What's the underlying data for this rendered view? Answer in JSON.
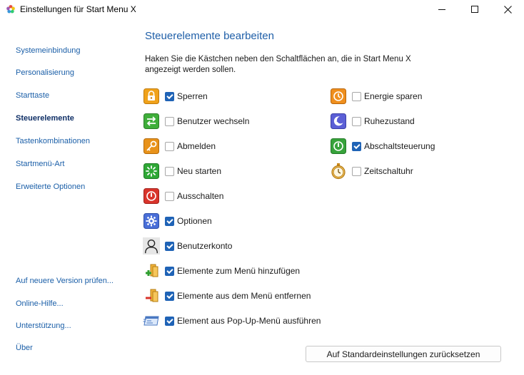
{
  "window": {
    "title": "Einstellungen für Start Menu X",
    "controls": [
      "minimize",
      "maximize",
      "close"
    ]
  },
  "sidebar": {
    "top_items": [
      {
        "label": "Systemeinbindung",
        "active": false
      },
      {
        "label": "Personalisierung",
        "active": false
      },
      {
        "label": "Starttaste",
        "active": false
      },
      {
        "label": "Steuerelemente",
        "active": true
      },
      {
        "label": "Tastenkombinationen",
        "active": false
      },
      {
        "label": "Startmenü-Art",
        "active": false
      },
      {
        "label": "Erweiterte Optionen",
        "active": false
      }
    ],
    "bottom_items": [
      {
        "label": "Auf neuere Version prüfen..."
      },
      {
        "label": "Online-Hilfe..."
      },
      {
        "label": "Unterstützung..."
      },
      {
        "label": "Über"
      }
    ]
  },
  "main": {
    "heading": "Steuerelemente bearbeiten",
    "description": "Haken Sie die Kästchen neben den Schaltflächen an, die in Start Menu X angezeigt werden sollen.",
    "left_column": [
      {
        "label": "Sperren",
        "checked": true,
        "icon": "lock-icon"
      },
      {
        "label": "Benutzer wechseln",
        "checked": false,
        "icon": "switch-user-icon"
      },
      {
        "label": "Abmelden",
        "checked": false,
        "icon": "key-icon"
      },
      {
        "label": "Neu starten",
        "checked": false,
        "icon": "restart-icon"
      },
      {
        "label": "Ausschalten",
        "checked": false,
        "icon": "power-off-icon"
      },
      {
        "label": "Optionen",
        "checked": true,
        "icon": "gear-icon"
      },
      {
        "label": "Benutzerkonto",
        "checked": true,
        "icon": "user-icon"
      },
      {
        "label": "Elemente zum Menü hinzufügen",
        "checked": true,
        "icon": "add-items-icon"
      },
      {
        "label": "Elemente aus dem Menü entfernen",
        "checked": true,
        "icon": "remove-items-icon"
      },
      {
        "label": "Element aus Pop-Up-Menü ausführen",
        "checked": true,
        "icon": "run-popup-icon"
      }
    ],
    "right_column": [
      {
        "label": "Energie sparen",
        "checked": false,
        "icon": "sleep-power-icon"
      },
      {
        "label": "Ruhezustand",
        "checked": false,
        "icon": "hibernate-moon-icon"
      },
      {
        "label": "Abschaltsteuerung",
        "checked": true,
        "icon": "shutdown-control-icon"
      },
      {
        "label": "Zeitschaltuhr",
        "checked": false,
        "icon": "timer-clock-icon"
      }
    ],
    "reset_button": "Auf Standardeinstellungen zurücksetzen"
  },
  "colors": {
    "link": "#1b5fa8",
    "active_link": "#0f2f66",
    "heading": "#1f5fa8",
    "checkbox_checked": "#1f63b6"
  }
}
